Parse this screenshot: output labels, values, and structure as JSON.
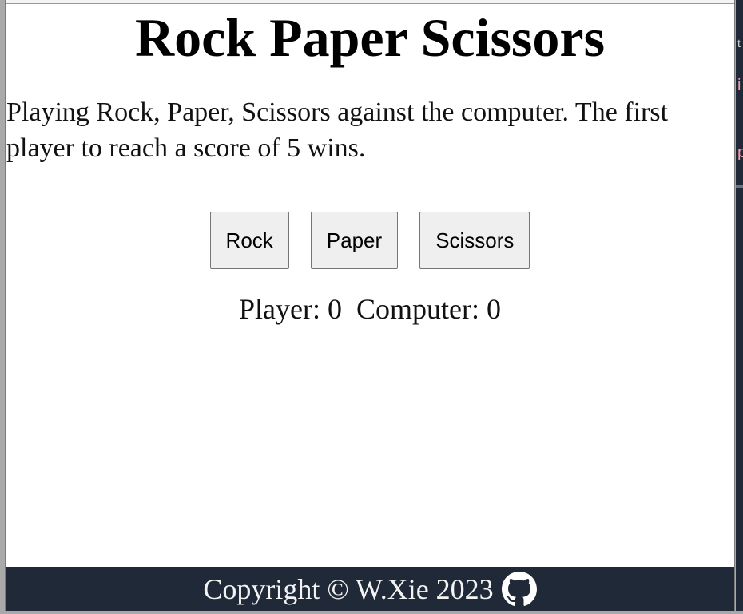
{
  "header": {
    "title": "Rock Paper Scissors"
  },
  "intro": {
    "text": "Playing Rock, Paper, Scissors against the computer. The first player to reach a score of 5 wins."
  },
  "choices": {
    "rock": "Rock",
    "paper": "Paper",
    "scissors": "Scissors"
  },
  "score": {
    "player_label": "Player:",
    "player_value": "0",
    "computer_label": "Computer:",
    "computer_value": "0"
  },
  "footer": {
    "copyright": "Copyright © W.Xie 2023",
    "icon": "github-icon"
  },
  "colors": {
    "footer_bg": "#1f2937",
    "page_bg": "#ffffff"
  }
}
